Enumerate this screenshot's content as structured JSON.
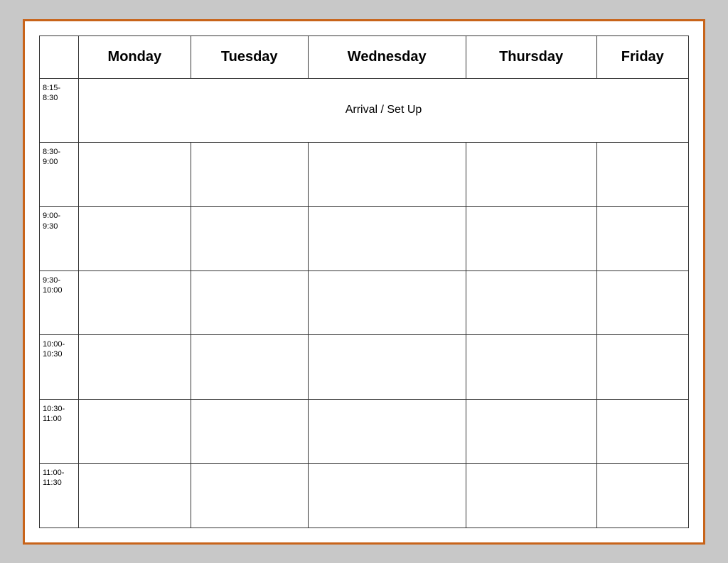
{
  "table": {
    "headers": {
      "time_col": "",
      "monday": "Monday",
      "tuesday": "Tuesday",
      "wednesday": "Wednesday",
      "thursday": "Thursday",
      "friday": "Friday"
    },
    "rows": [
      {
        "time": "8:15-\n8:30",
        "span_text": "Arrival / Set Up",
        "is_arrival": true
      },
      {
        "time": "8:30-\n9:00",
        "is_arrival": false
      },
      {
        "time": "9:00-\n9:30",
        "is_arrival": false
      },
      {
        "time": "9:30-\n10:00",
        "is_arrival": false
      },
      {
        "time": "10:00-\n10:30",
        "is_arrival": false
      },
      {
        "time": "10:30-\n11:00",
        "is_arrival": false
      },
      {
        "time": "11:00-\n11:30",
        "is_arrival": false
      }
    ]
  }
}
